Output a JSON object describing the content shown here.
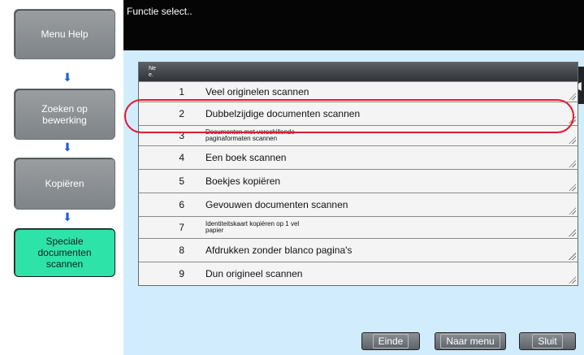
{
  "header": {
    "title": "Functie select.."
  },
  "leftnav": {
    "items": [
      {
        "label": "Menu Help"
      },
      {
        "label": "Zoeken op bewerking"
      },
      {
        "label": "Kopiëren"
      },
      {
        "label": "Speciale documenten scannen",
        "active": true
      }
    ],
    "arrow_icon": "arrow-down-icon",
    "arrow_color": "#1f5fe0",
    "active_color": "#2ee3a7"
  },
  "list": {
    "header_label": "Ne\ne.",
    "rows": [
      {
        "num": "1",
        "label": "Veel originelen scannen"
      },
      {
        "num": "2",
        "label": "Dubbelzijdige documenten scannen"
      },
      {
        "num": "3",
        "label": "Documenten met verschillende paginaformaten scannen"
      },
      {
        "num": "4",
        "label": "Een boek scannen"
      },
      {
        "num": "5",
        "label": "Boekjes kopiëren"
      },
      {
        "num": "6",
        "label": "Gevouwen documenten scannen"
      },
      {
        "num": "7",
        "label": "Identiteitskaart kopiëren op 1 vel papier"
      },
      {
        "num": "8",
        "label": "Afdrukken zonder blanco pagina's"
      },
      {
        "num": "9",
        "label": "Dun origineel scannen"
      }
    ],
    "highlight_color": "#e3192e"
  },
  "sidetab": {
    "icon": "double-chevron-left-icon",
    "glyph": "◀◀"
  },
  "footer": {
    "buttons": [
      {
        "label": "Einde"
      },
      {
        "label": "Naar menu"
      },
      {
        "label": "Sluit"
      }
    ]
  },
  "colors": {
    "panel_bg": "#d0ecfd",
    "header_bg": "#050505"
  }
}
